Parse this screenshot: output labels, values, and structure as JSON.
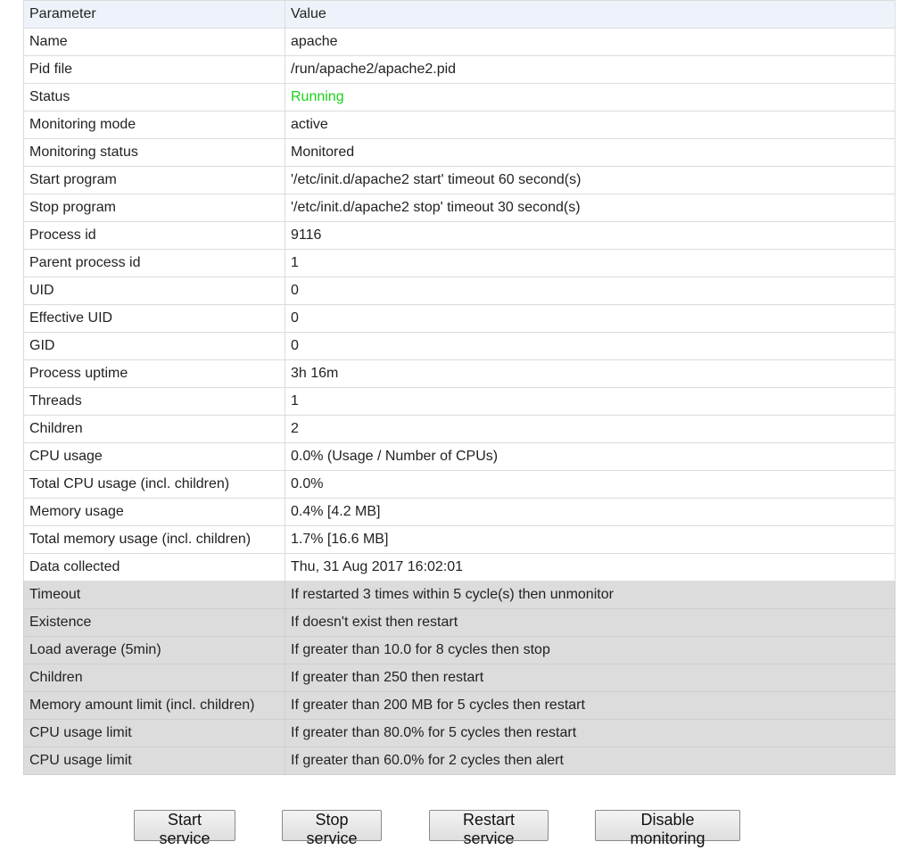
{
  "table": {
    "header": {
      "parameter": "Parameter",
      "value": "Value"
    },
    "rows": [
      {
        "param": "Name",
        "value": "apache"
      },
      {
        "param": "Pid file",
        "value": "/run/apache2/apache2.pid"
      },
      {
        "param": "Status",
        "value": "Running"
      },
      {
        "param": "Monitoring mode",
        "value": "active"
      },
      {
        "param": "Monitoring status",
        "value": "Monitored"
      },
      {
        "param": "Start program",
        "value": "'/etc/init.d/apache2 start' timeout 60 second(s)"
      },
      {
        "param": "Stop program",
        "value": "'/etc/init.d/apache2 stop' timeout 30 second(s)"
      },
      {
        "param": "Process id",
        "value": "9116"
      },
      {
        "param": "Parent process id",
        "value": "1"
      },
      {
        "param": "UID",
        "value": "0"
      },
      {
        "param": "Effective UID",
        "value": "0"
      },
      {
        "param": "GID",
        "value": "0"
      },
      {
        "param": "Process uptime",
        "value": "3h 16m"
      },
      {
        "param": "Threads",
        "value": "1"
      },
      {
        "param": "Children",
        "value": "2"
      },
      {
        "param": "CPU usage",
        "value": "0.0% (Usage / Number of CPUs)"
      },
      {
        "param": "Total CPU usage (incl. children)",
        "value": "0.0%"
      },
      {
        "param": "Memory usage",
        "value": "0.4% [4.2 MB]"
      },
      {
        "param": "Total memory usage (incl. children)",
        "value": "1.7% [16.6 MB]"
      },
      {
        "param": "Data collected",
        "value": "Thu, 31 Aug 2017 16:02:01"
      }
    ],
    "rules": [
      {
        "param": "Timeout",
        "value": "If restarted 3 times within 5 cycle(s) then unmonitor"
      },
      {
        "param": "Existence",
        "value": "If doesn't exist then restart"
      },
      {
        "param": "Load average (5min)",
        "value": "If greater than 10.0 for 8 cycles then stop"
      },
      {
        "param": "Children",
        "value": "If greater than 250 then restart"
      },
      {
        "param": "Memory amount limit (incl. children)",
        "value": "If greater than 200 MB for 5 cycles then restart"
      },
      {
        "param": "CPU usage limit",
        "value": "If greater than 80.0% for 5 cycles then restart"
      },
      {
        "param": "CPU usage limit",
        "value": "If greater than 60.0% for 2 cycles then alert"
      }
    ]
  },
  "buttons": {
    "start": "Start service",
    "stop": "Stop service",
    "restart": "Restart service",
    "disable": "Disable monitoring"
  },
  "colors": {
    "header_bg": "#eef3fb",
    "rule_bg": "#dcdcdc",
    "status_running": "#19d219"
  }
}
